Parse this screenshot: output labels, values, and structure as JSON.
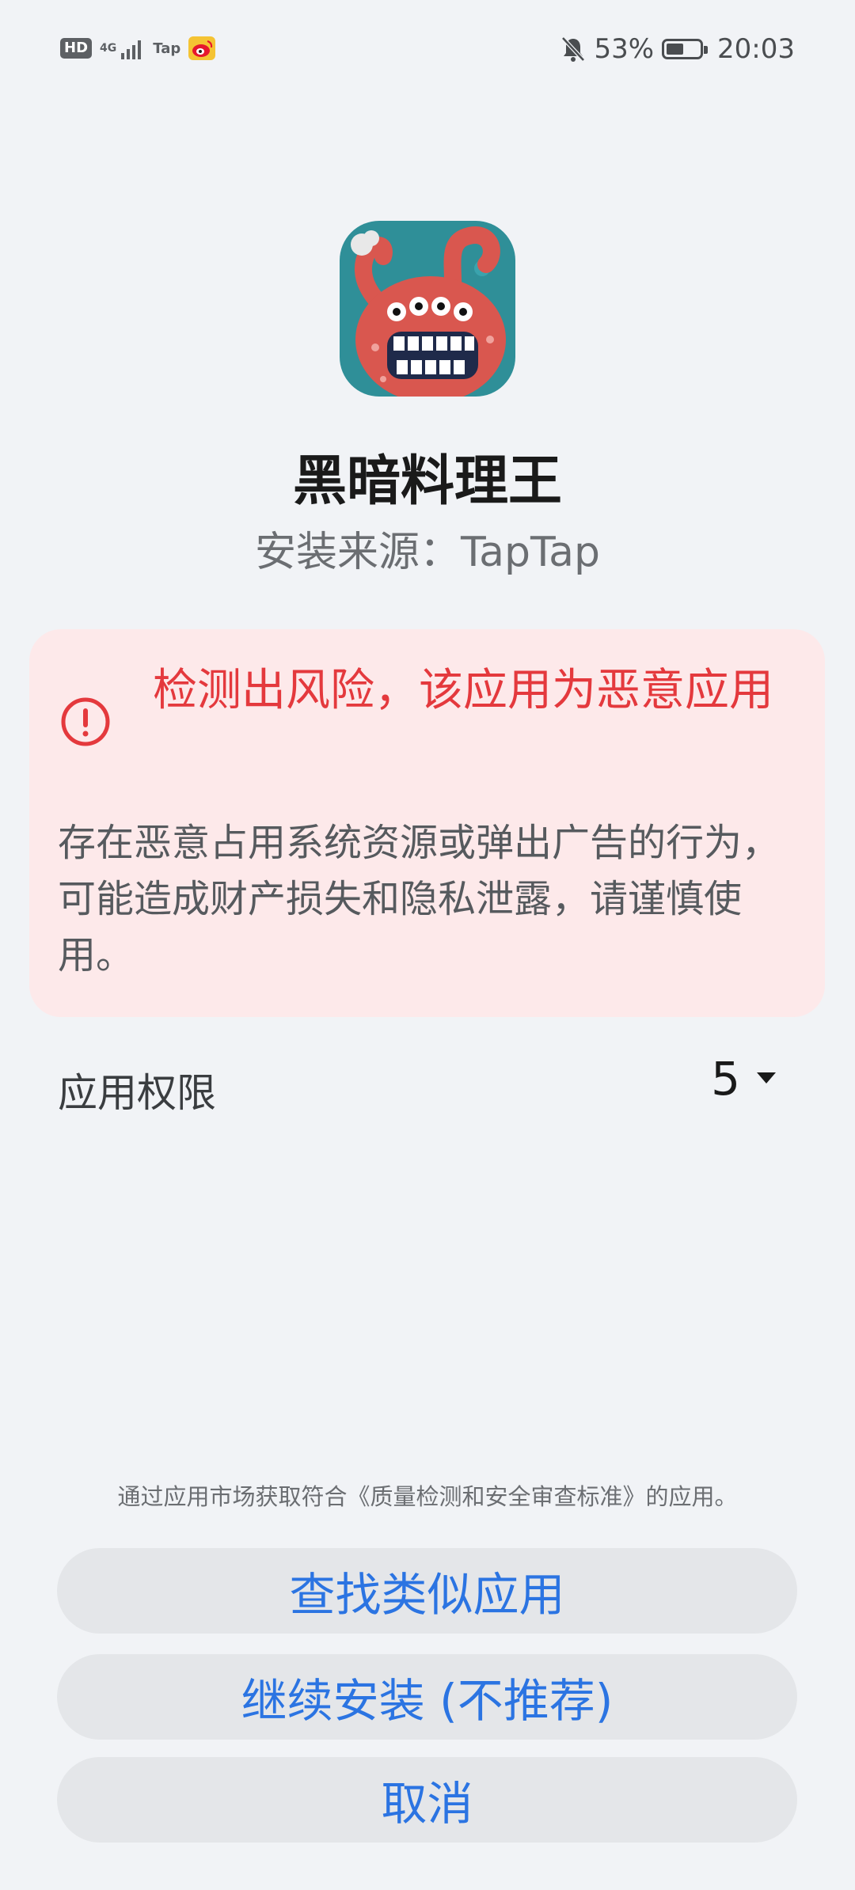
{
  "status_bar": {
    "hd": "HD",
    "network": "4G",
    "tap": "Tap",
    "battery_percent": "53%",
    "battery_level": 0.53,
    "time": "20:03"
  },
  "app": {
    "name": "黑暗料理王",
    "install_source": "安装来源：TapTap",
    "icon": "octopus-monster-app-icon"
  },
  "risk": {
    "title": "检测出风险，该应用为恶意应用",
    "description": "存在恶意占用系统资源或弹出广告的行为，可能造成财产损失和隐私泄露，请谨慎使用。",
    "color": "#e4393d",
    "background": "#fde9ea"
  },
  "permissions": {
    "label": "应用权限",
    "count": "5"
  },
  "footer": {
    "note": "通过应用市场获取符合《质量检测和安全审查标准》的应用。"
  },
  "buttons": {
    "find_similar": "查找类似应用",
    "continue_install": "继续安装 (不推荐)",
    "cancel": "取消",
    "accent": "#2b74e2"
  }
}
